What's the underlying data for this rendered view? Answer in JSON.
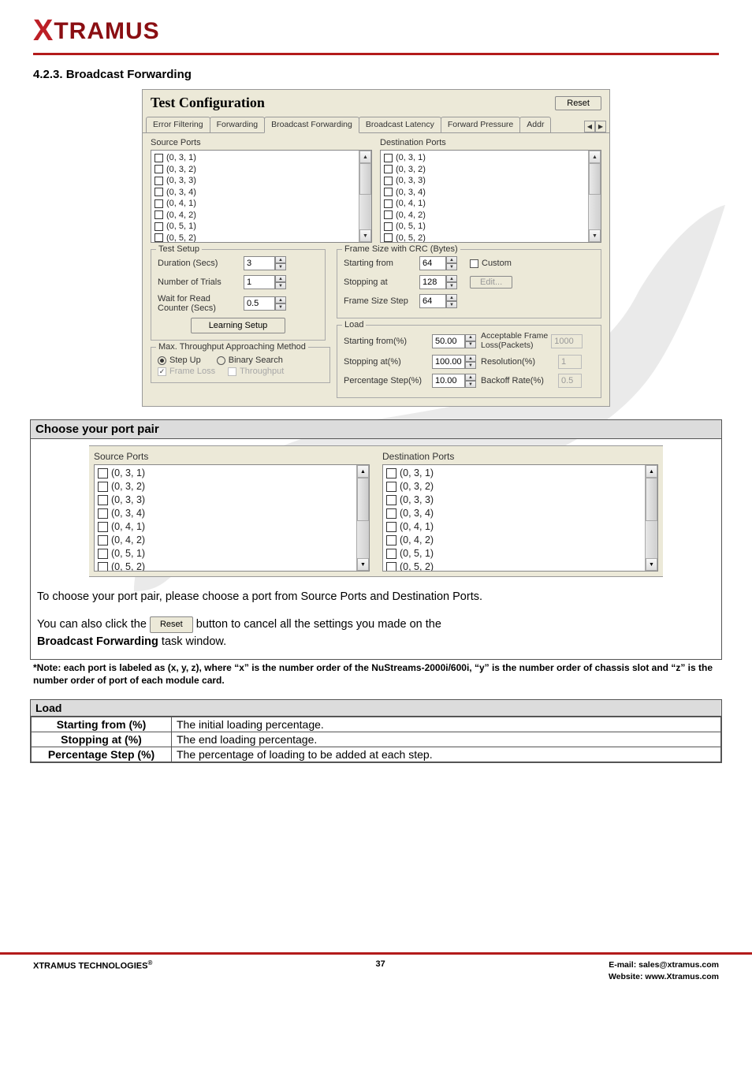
{
  "logo": {
    "prefix": "X",
    "rest": "TRAMUS"
  },
  "section_title": "4.2.3. Broadcast Forwarding",
  "dialog": {
    "title": "Test Configuration",
    "reset_label": "Reset",
    "tabs": {
      "items": [
        "Error Filtering",
        "Forwarding",
        "Broadcast Forwarding",
        "Broadcast Latency",
        "Forward Pressure",
        "Addr"
      ],
      "scroll_left": "◀",
      "scroll_right": "▶",
      "selected_index": 2
    },
    "source_ports_label": "Source Ports",
    "destination_ports_label": "Destination Ports",
    "ports": [
      "(0, 3, 1)",
      "(0, 3, 2)",
      "(0, 3, 3)",
      "(0, 3, 4)",
      "(0, 4, 1)",
      "(0, 4, 2)",
      "(0, 5, 1)",
      "(0, 5, 2)"
    ],
    "test_setup": {
      "legend": "Test Setup",
      "duration_label": "Duration (Secs)",
      "duration_value": "3",
      "trials_label": "Number of Trials",
      "trials_value": "1",
      "wait_label_1": "Wait for Read",
      "wait_label_2": "Counter (Secs)",
      "wait_value": "0.5",
      "learning_button": "Learning Setup"
    },
    "approach": {
      "legend": "Max. Throughput Approaching Method",
      "step_up": "Step Up",
      "binary_search": "Binary Search",
      "frame_loss": "Frame Loss",
      "throughput": "Throughput"
    },
    "frame_size": {
      "legend": "Frame Size with CRC (Bytes)",
      "start_label": "Starting from",
      "start_value": "64",
      "stop_label": "Stopping at",
      "stop_value": "128",
      "step_label": "Frame Size Step",
      "step_value": "64",
      "custom_label": "Custom",
      "edit_button": "Edit..."
    },
    "load": {
      "legend": "Load",
      "start_label": "Starting from(%)",
      "start_value": "50.00",
      "stop_label": "Stopping at(%)",
      "stop_value": "100.00",
      "pct_step_label": "Percentage Step(%)",
      "pct_step_value": "10.00",
      "afl_label_1": "Acceptable Frame",
      "afl_label_2": "Loss(Packets)",
      "afl_value": "1000",
      "res_label": "Resolution(%)",
      "res_value": "1",
      "backoff_label": "Backoff Rate(%)",
      "backoff_value": "0.5"
    }
  },
  "port_pair": {
    "header": "Choose your port pair",
    "source_label": "Source Ports",
    "dest_label": "Destination Ports",
    "ports": [
      "(0, 3, 1)",
      "(0, 3, 2)",
      "(0, 3, 3)",
      "(0, 3, 4)",
      "(0, 4, 1)",
      "(0, 4, 2)",
      "(0, 5, 1)",
      "(0, 5, 2)"
    ],
    "para1": "To choose your port pair, please choose a port from Source Ports and Destination Ports.",
    "para2_pre": "You can also click the ",
    "para2_btn": "Reset",
    "para2_post": " button to cancel all the settings you made on the ",
    "para2_bold": "Broadcast Forwarding",
    "para2_tail": " task window."
  },
  "note_text": "*Note: each port is labeled as (x, y, z), where “x” is the number order of the NuStreams-2000i/600i, “y” is the number order of chassis slot and “z” is the number order of port of each module card.",
  "load_table": {
    "header": "Load",
    "rows": [
      {
        "label": "Starting from (%)",
        "desc": "The initial loading percentage."
      },
      {
        "label": "Stopping at (%)",
        "desc": "The end loading percentage."
      },
      {
        "label": "Percentage Step (%)",
        "desc": "The percentage of loading to be added at each step."
      }
    ]
  },
  "footer": {
    "left": "XTRAMUS TECHNOLOGIES",
    "reg": "®",
    "page": "37",
    "email": "E-mail: sales@xtramus.com",
    "website": "Website:  www.Xtramus.com"
  }
}
